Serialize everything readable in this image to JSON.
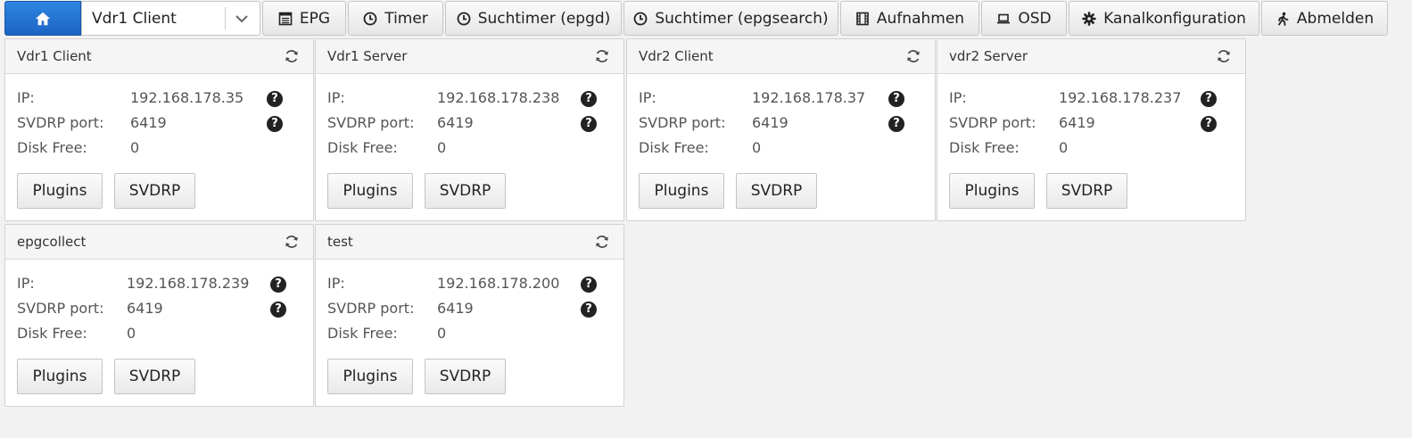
{
  "toolbar": {
    "client_select": "Vdr1 Client",
    "items": [
      {
        "label": "EPG",
        "icon": "epg-icon"
      },
      {
        "label": "Timer",
        "icon": "clock-icon"
      },
      {
        "label": "Suchtimer (epgd)",
        "icon": "clock-icon"
      },
      {
        "label": "Suchtimer (epgsearch)",
        "icon": "clock-icon"
      },
      {
        "label": "Aufnahmen",
        "icon": "film-icon"
      },
      {
        "label": "OSD",
        "icon": "laptop-icon"
      },
      {
        "label": "Kanalkonfiguration",
        "icon": "gear-icon"
      },
      {
        "label": "Abmelden",
        "icon": "walking-person-icon"
      }
    ]
  },
  "labels": {
    "ip": "IP:",
    "svdrp_port": "SVDRP port:",
    "disk_free": "Disk Free:",
    "plugins": "Plugins",
    "svdrp": "SVDRP",
    "help": "?"
  },
  "panels": [
    {
      "title": "Vdr1 Client",
      "ip": "192.168.178.35",
      "port": "6419",
      "disk_free": "0"
    },
    {
      "title": "Vdr1 Server",
      "ip": "192.168.178.238",
      "port": "6419",
      "disk_free": "0"
    },
    {
      "title": "Vdr2 Client",
      "ip": "192.168.178.37",
      "port": "6419",
      "disk_free": "0"
    },
    {
      "title": "vdr2 Server",
      "ip": "192.168.178.237",
      "port": "6419",
      "disk_free": "0"
    },
    {
      "title": "epgcollect",
      "ip": "192.168.178.239",
      "port": "6419",
      "disk_free": "0"
    },
    {
      "title": "test",
      "ip": "192.168.178.200",
      "port": "6419",
      "disk_free": "0"
    }
  ],
  "colors": {
    "home_button": "#1b64c4",
    "page_background": "#f2f2f2"
  }
}
